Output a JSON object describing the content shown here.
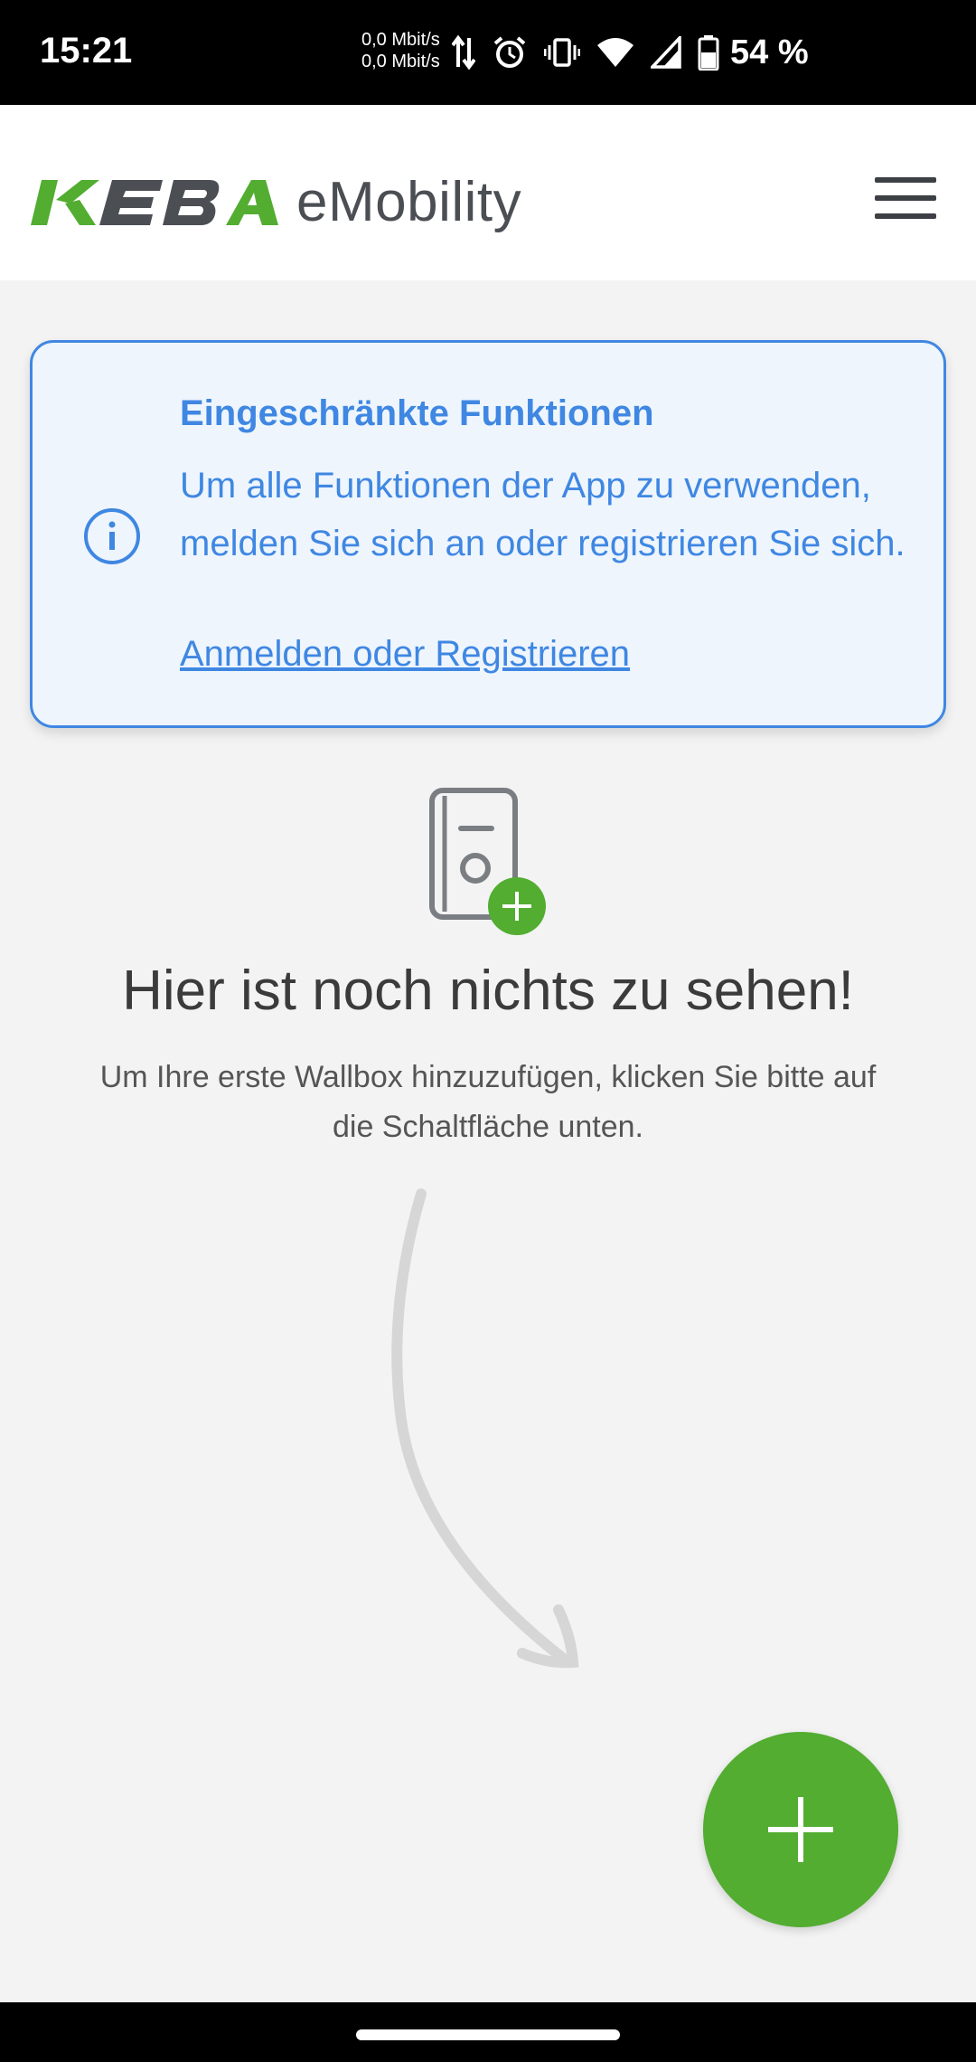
{
  "status_bar": {
    "time": "15:21",
    "net_up": "0,0 Mbit/s",
    "net_down": "0,0 Mbit/s",
    "battery": "54 %"
  },
  "header": {
    "logo_text": "KEBA",
    "logo_sub": "eMobility",
    "menu_icon": "hamburger-menu-icon"
  },
  "info_card": {
    "title": "Eingeschränkte Funktionen",
    "message": "Um alle Funktionen der App zu verwenden, melden Sie sich an oder registrieren Sie sich.",
    "link": "Anmelden oder Registrieren",
    "icon": "info-icon"
  },
  "empty_state": {
    "title": "Hier ist noch nichts zu sehen!",
    "description": "Um Ihre erste Wallbox hinzuzufügen, klicken Sie bitte auf die Schaltfläche unten."
  },
  "fab": {
    "icon": "plus-icon"
  },
  "colors": {
    "brand_green": "#52ad31",
    "brand_gray": "#4b4f54",
    "info_blue": "#3f87e2",
    "card_bg": "#eef5fd",
    "page_bg": "#f3f3f3"
  }
}
